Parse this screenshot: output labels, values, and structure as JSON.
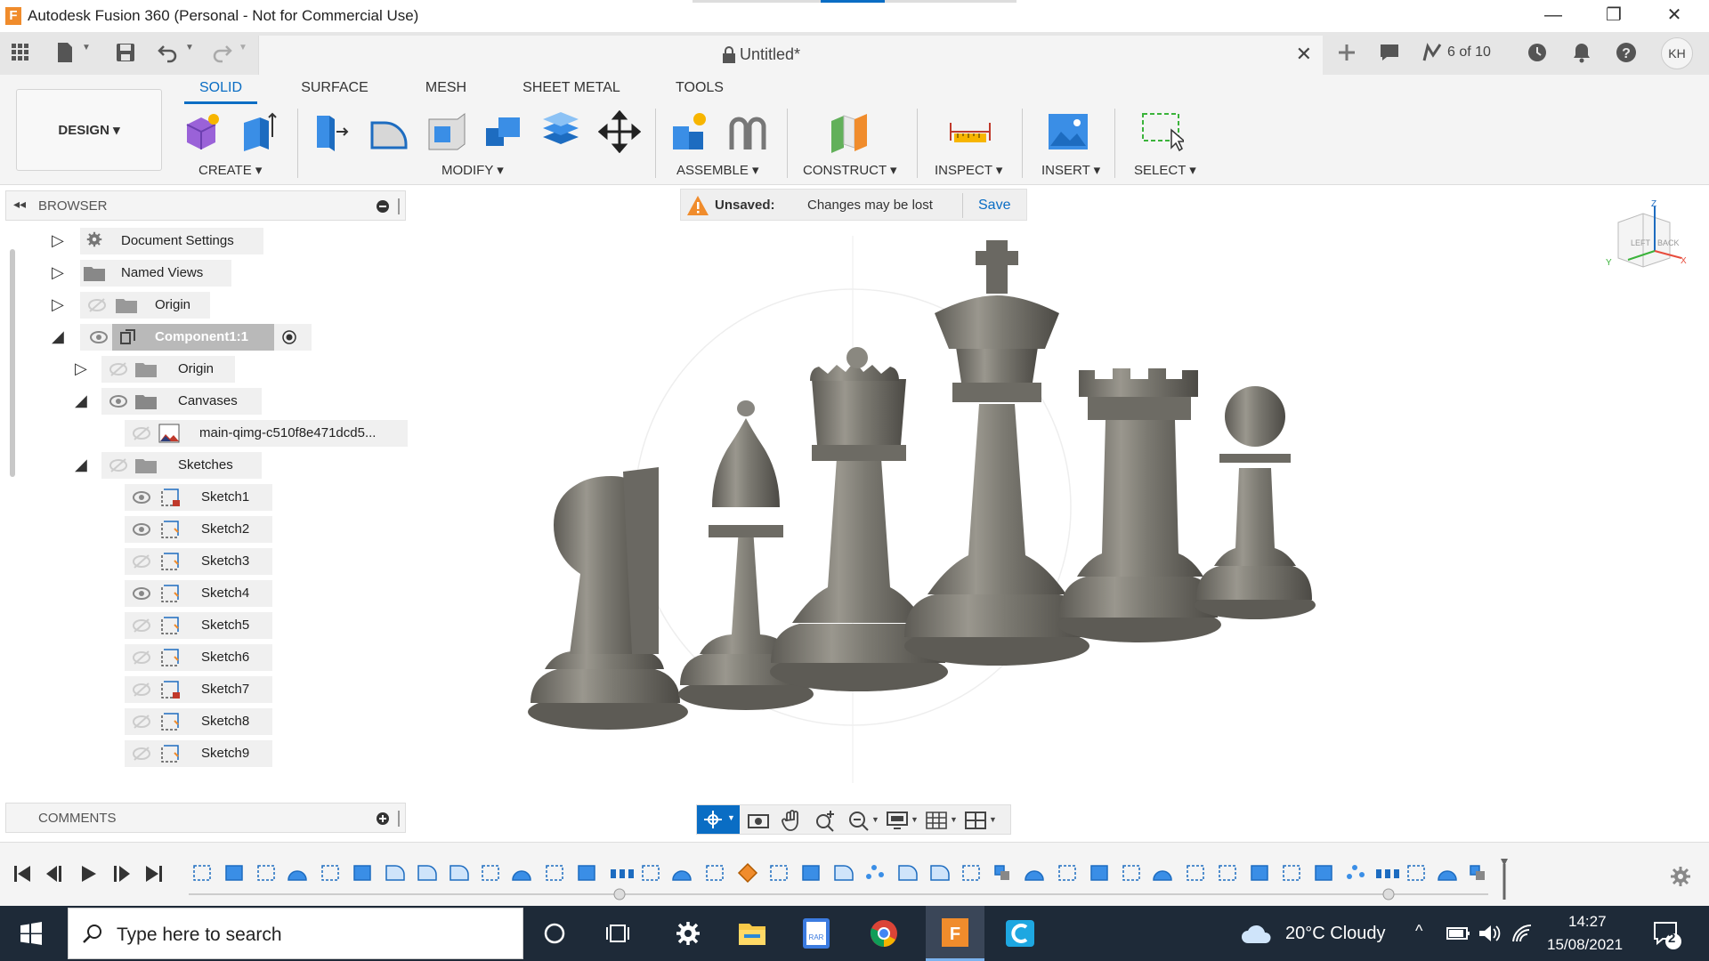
{
  "window": {
    "title": "Autodesk Fusion 360 (Personal - Not for Commercial Use)",
    "app_icon_letter": "F",
    "minimize": "—",
    "restore": "❐",
    "close": "✕"
  },
  "toolbar": {
    "document_title": "Untitled*",
    "tab_close": "✕",
    "job_status": "6 of 10",
    "user_initials": "KH"
  },
  "workspace": {
    "label": "DESIGN ▾"
  },
  "ribbon": {
    "tabs": [
      "SOLID",
      "SURFACE",
      "MESH",
      "SHEET METAL",
      "TOOLS"
    ],
    "active_tab": "SOLID",
    "groups": {
      "create": "CREATE ▾",
      "modify": "MODIFY ▾",
      "assemble": "ASSEMBLE ▾",
      "construct": "CONSTRUCT ▾",
      "inspect": "INSPECT ▾",
      "insert": "INSERT ▾",
      "select": "SELECT ▾"
    }
  },
  "browser": {
    "title": "BROWSER",
    "items": [
      {
        "label": "Document Settings"
      },
      {
        "label": "Named Views"
      },
      {
        "label": "Origin"
      },
      {
        "label": "Component1:1"
      },
      {
        "label": "Origin"
      },
      {
        "label": "Canvases"
      },
      {
        "label": "main-qimg-c510f8e471dcd5..."
      },
      {
        "label": "Sketches"
      },
      {
        "label": "Sketch1"
      },
      {
        "label": "Sketch2"
      },
      {
        "label": "Sketch3"
      },
      {
        "label": "Sketch4"
      },
      {
        "label": "Sketch5"
      },
      {
        "label": "Sketch6"
      },
      {
        "label": "Sketch7"
      },
      {
        "label": "Sketch8"
      },
      {
        "label": "Sketch9"
      }
    ]
  },
  "comments": {
    "title": "COMMENTS"
  },
  "notification": {
    "status": "Unsaved:",
    "message": "Changes may be lost",
    "action": "Save"
  },
  "viewcube": {
    "left": "LEFT",
    "back": "BACK",
    "axis_z": "Z",
    "axis_x": "X",
    "axis_y": "Y"
  },
  "taskbar": {
    "search_placeholder": "Type here to search",
    "weather": "20°C  Cloudy",
    "time": "14:27",
    "date": "15/08/2021",
    "notification_count": "2"
  },
  "colors": {
    "accent": "#0a6dc4",
    "taskbar": "#1e2a38",
    "piece": "#7c7a72"
  }
}
